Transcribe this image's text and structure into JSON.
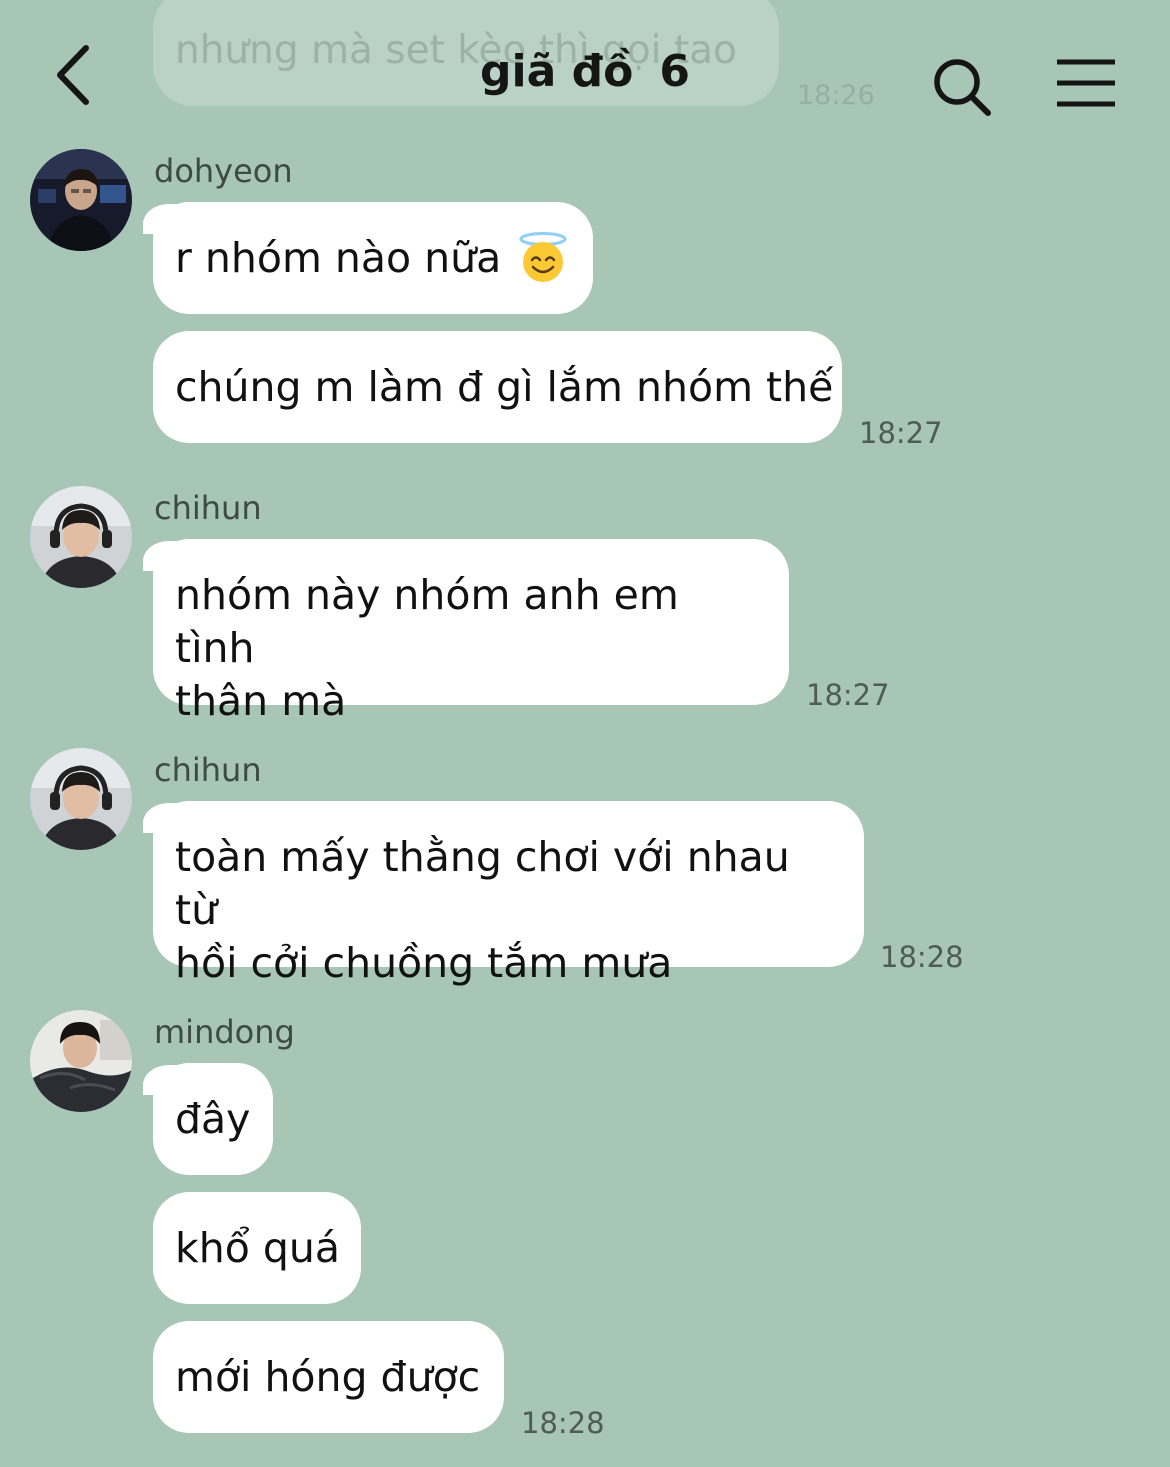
{
  "header": {
    "title": "giã đồ",
    "member_count": "6"
  },
  "previous_message": {
    "text": "nhưng mà set kèo thì gọi tao",
    "time": "18:26"
  },
  "groups": [
    {
      "sender": "dohyeon",
      "avatar": "avatar-dohyeon",
      "messages": [
        {
          "text": "r nhóm nào nữa",
          "emoji": "smiling-face-with-halo-emoji"
        },
        {
          "text": "chúng m làm đ gì lắm nhóm thế"
        }
      ],
      "time": "18:27"
    },
    {
      "sender": "chihun",
      "avatar": "avatar-chihun",
      "messages": [
        {
          "line1": "nhóm này nhóm anh em tình",
          "line2": "thân mà"
        }
      ],
      "time": "18:27"
    },
    {
      "sender": "chihun",
      "avatar": "avatar-chihun",
      "messages": [
        {
          "line1": "toàn mấy thằng chơi với nhau từ",
          "line2": "hồi cởi chuồng tắm mưa"
        }
      ],
      "time": "18:28"
    },
    {
      "sender": "mindong",
      "avatar": "avatar-mindong",
      "messages": [
        {
          "text": "đây"
        },
        {
          "text": "khổ quá"
        },
        {
          "text": "mới hóng được"
        }
      ],
      "time": "18:28"
    }
  ],
  "colors": {
    "background": "#a7c6b6",
    "bubble": "#ffffff",
    "meta_text": "#4f5b55"
  }
}
